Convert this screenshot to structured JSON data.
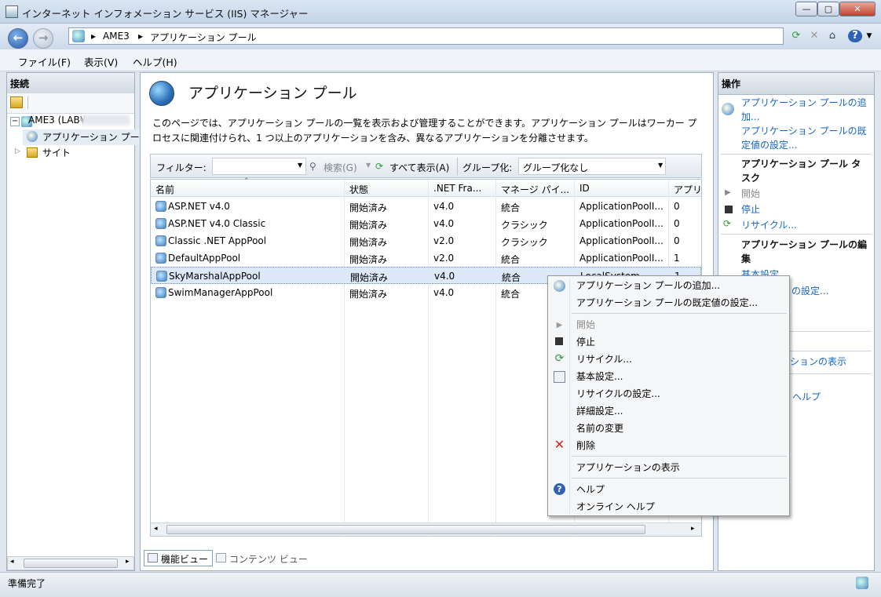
{
  "window": {
    "title": "インターネット インフォメーション サービス (IIS) マネージャー",
    "controls": {
      "minimize": "—",
      "maximize": "▢",
      "close": "✕"
    }
  },
  "address": {
    "segments": [
      "AME3",
      "アプリケーション プール"
    ],
    "separator": "▸"
  },
  "menu": [
    "ファイル(F)",
    "表示(V)",
    "ヘルプ(H)"
  ],
  "connections": {
    "header": "接続",
    "tree": [
      {
        "label": "AME3 (LAB¥",
        "level": 0
      },
      {
        "label": "アプリケーション プー",
        "level": 1
      },
      {
        "label": "サイト",
        "level": 1
      }
    ]
  },
  "main": {
    "title": "アプリケーション プール",
    "description": "このページでは、アプリケーション プールの一覧を表示および管理することができます。アプリケーション プールはワーカー プロセスに関連付けられ、1 つ以上のアプリケーションを含み、異なるアプリケーションを分離させます。",
    "filter": {
      "label": "フィルター:",
      "value": "",
      "search": "検索(G)",
      "show_all": "すべて表示(A)",
      "group_label": "グループ化:",
      "group_value": "グループ化なし"
    },
    "columns": [
      "名前",
      "状態",
      ".NET Fra...",
      "マネージ パイ...",
      "ID",
      "アプリ"
    ],
    "rows": [
      {
        "name": "ASP.NET v4.0",
        "status": "開始済み",
        "net": "v4.0",
        "pipeline": "統合",
        "id": "ApplicationPoolI...",
        "apps": "0"
      },
      {
        "name": "ASP.NET v4.0 Classic",
        "status": "開始済み",
        "net": "v4.0",
        "pipeline": "クラシック",
        "id": "ApplicationPoolI...",
        "apps": "0"
      },
      {
        "name": "Classic .NET AppPool",
        "status": "開始済み",
        "net": "v2.0",
        "pipeline": "クラシック",
        "id": "ApplicationPoolI...",
        "apps": "0"
      },
      {
        "name": "DefaultAppPool",
        "status": "開始済み",
        "net": "v2.0",
        "pipeline": "統合",
        "id": "ApplicationPoolI...",
        "apps": "1"
      },
      {
        "name": "SkyMarshalAppPool",
        "status": "開始済み",
        "net": "v4.0",
        "pipeline": "統合",
        "id": "LocalSystem",
        "apps": "1"
      },
      {
        "name": "SwimManagerAppPool",
        "status": "開始済み",
        "net": "v4.0",
        "pipeline": "統合",
        "id": "",
        "apps": ""
      }
    ],
    "view_tabs": [
      "機能ビュー",
      "コンテンツ ビュー"
    ]
  },
  "actions": {
    "header": "操作",
    "add_pool": "アプリケーション プールの追加...",
    "defaults": "アプリケーション プールの既定値の設定...",
    "tasks_header": "アプリケーション プール タスク",
    "start": "開始",
    "stop": "停止",
    "recycle": "リサイクル...",
    "edit_header": "アプリケーション プールの編集",
    "basic": "基本設定...",
    "recycle_settings": "の設定...",
    "view_apps": "ションの表示",
    "help": "ヘルプ"
  },
  "context_menu": {
    "items": [
      {
        "label": "アプリケーション プールの追加...",
        "enabled": true,
        "icon": "add-pool-icon"
      },
      {
        "label": "アプリケーション プールの既定値の設定...",
        "enabled": true,
        "icon": ""
      },
      {
        "sep": true
      },
      {
        "label": "開始",
        "enabled": false,
        "icon": "play-icon"
      },
      {
        "label": "停止",
        "enabled": true,
        "icon": "stop-icon"
      },
      {
        "label": "リサイクル...",
        "enabled": true,
        "icon": "recycle-icon"
      },
      {
        "label": "基本設定...",
        "enabled": true,
        "icon": "settings-icon"
      },
      {
        "label": "リサイクルの設定...",
        "enabled": true,
        "icon": ""
      },
      {
        "label": "詳細設定...",
        "enabled": true,
        "icon": ""
      },
      {
        "label": "名前の変更",
        "enabled": true,
        "icon": ""
      },
      {
        "label": "削除",
        "enabled": true,
        "icon": "delete-icon"
      },
      {
        "sep": true
      },
      {
        "label": "アプリケーションの表示",
        "enabled": true,
        "icon": ""
      },
      {
        "sep": true
      },
      {
        "label": "ヘルプ",
        "enabled": true,
        "icon": "help-icon"
      },
      {
        "label": "オンライン ヘルプ",
        "enabled": true,
        "icon": ""
      }
    ]
  },
  "status": {
    "text": "準備完了"
  },
  "colors": {
    "link": "#1565c0",
    "selection": "#dde9f8",
    "delete": "#d42020",
    "recycle": "#2e9e3a"
  }
}
